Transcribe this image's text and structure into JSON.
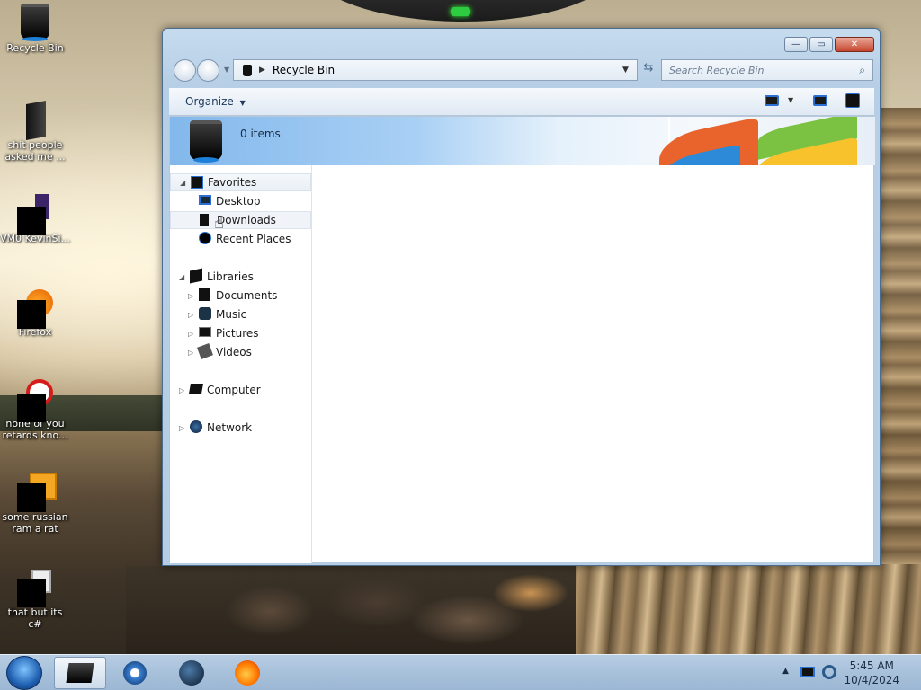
{
  "desktop": {
    "icons": [
      {
        "label": "Recycle Bin"
      },
      {
        "label": "shit people asked me ..."
      },
      {
        "label": "VM0 KevinSi..."
      },
      {
        "label": "Firefox"
      },
      {
        "label": "none of you retards kno..."
      },
      {
        "label": "some russian ram a rat"
      },
      {
        "label": "that but its c#"
      }
    ]
  },
  "window": {
    "title": "Recycle Bin",
    "controls": {
      "minimize": "—",
      "maximize": "▭",
      "close": "✕"
    },
    "address": {
      "location": "Recycle Bin"
    },
    "search": {
      "placeholder": "Search Recycle Bin"
    },
    "toolbar": {
      "organize_label": "Organize"
    },
    "banner": {
      "item_count": "0 items"
    },
    "navigation": {
      "favorites": {
        "label": "Favorites",
        "items": [
          "Desktop",
          "Downloads",
          "Recent Places"
        ]
      },
      "libraries": {
        "label": "Libraries",
        "items": [
          "Documents",
          "Music",
          "Pictures",
          "Videos"
        ]
      },
      "computer": {
        "label": "Computer"
      },
      "network": {
        "label": "Network"
      }
    }
  },
  "taskbar": {
    "clock": {
      "time": "5:45 AM",
      "date": "10/4/2024"
    }
  },
  "colors": {
    "accent_blue": "#2a6fd1",
    "window_frame": "#b6cde3",
    "close_red": "#c6452e"
  }
}
